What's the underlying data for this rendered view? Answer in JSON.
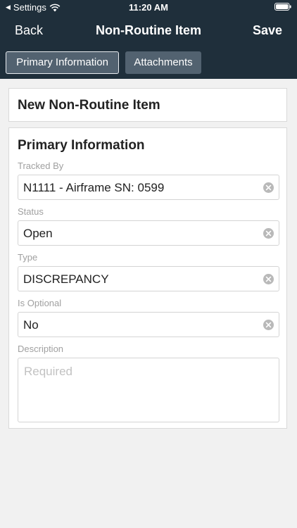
{
  "status_bar": {
    "back_app": "Settings",
    "time": "11:20 AM"
  },
  "nav": {
    "back_label": "Back",
    "title": "Non-Routine Item",
    "save_label": "Save"
  },
  "tabs": [
    {
      "label": "Primary Information",
      "selected": true
    },
    {
      "label": "Attachments",
      "selected": false
    }
  ],
  "item_title": "New Non-Routine Item",
  "form": {
    "section_title": "Primary Information",
    "fields": [
      {
        "label": "Tracked By",
        "value": "N1111 - Airframe SN: 0599"
      },
      {
        "label": "Status",
        "value": "Open"
      },
      {
        "label": "Type",
        "value": "DISCREPANCY"
      },
      {
        "label": "Is Optional",
        "value": "No"
      }
    ],
    "description": {
      "label": "Description",
      "placeholder": "Required",
      "value": ""
    }
  },
  "colors": {
    "header_bg": "#1f2f3b",
    "tab_bg": "#526270",
    "page_bg": "#f1f1f1"
  },
  "icons": {
    "clear": "clear-circle-x-icon",
    "wifi": "wifi-icon",
    "battery": "battery-icon"
  }
}
